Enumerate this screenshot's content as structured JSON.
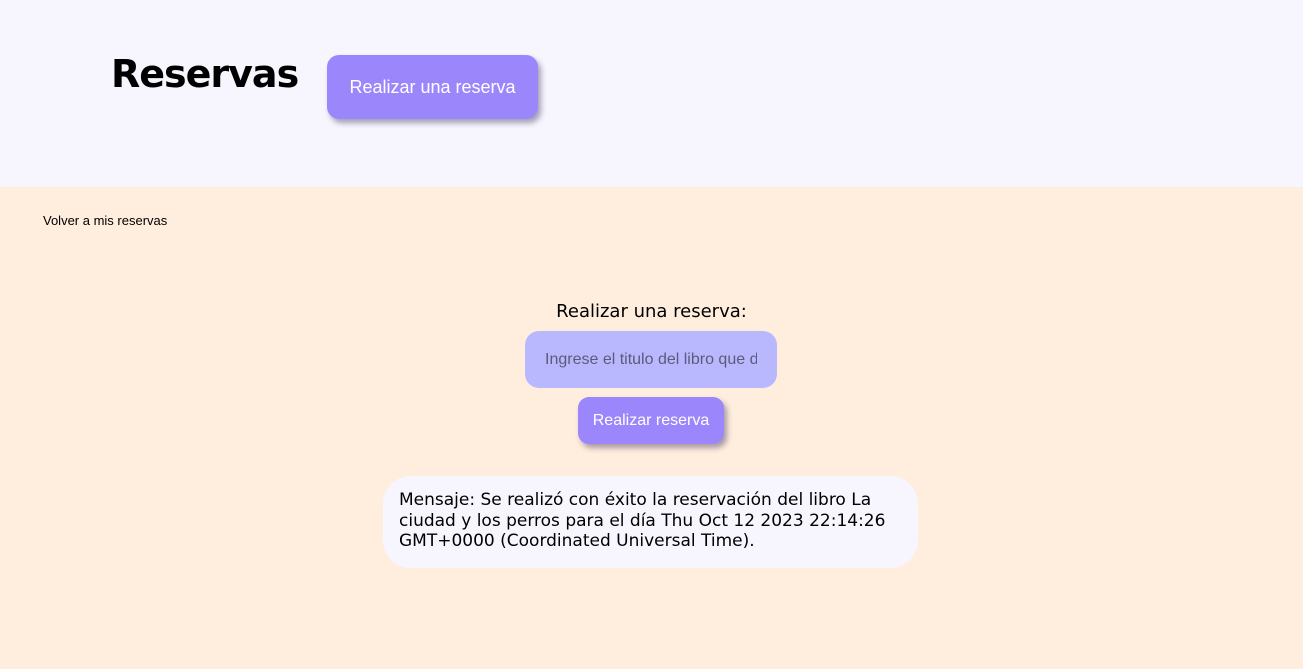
{
  "header": {
    "title": "Reservas",
    "reserve_button_label": "Realizar una reserva"
  },
  "nav": {
    "back_link": "Volver a mis reservas"
  },
  "form": {
    "title": "Realizar una reserva:",
    "input_placeholder": "Ingrese el titulo del libro que desea reservar",
    "input_value": "",
    "submit_label": "Realizar reserva"
  },
  "message": {
    "text": "Mensaje: Se realizó con éxito la reservación del libro La ciudad y los perros para el día Thu Oct 12 2023 22:14:26 GMT+0000 (Coordinated Universal Time)."
  },
  "colors": {
    "header_bg": "#f7f6ff",
    "page_bg": "#ffeede",
    "accent": "#9b87fb",
    "input_bg": "#b9b8ff"
  }
}
